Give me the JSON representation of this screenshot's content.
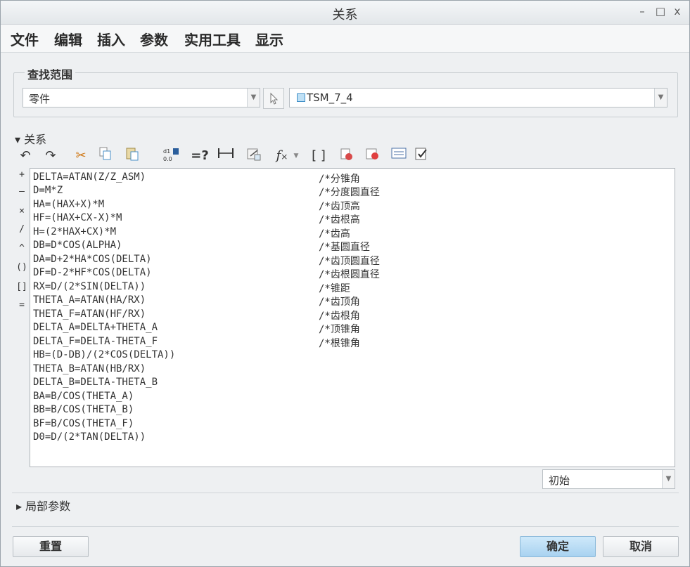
{
  "window": {
    "title": "关系",
    "min": "–",
    "max": "□",
    "close": "x"
  },
  "menu": [
    "文件",
    "编辑",
    "插入",
    "参数",
    "实用工具",
    "显示"
  ],
  "lookup": {
    "group_title": "查找范围",
    "scope_value": "零件",
    "model_value": "TSM_7_4"
  },
  "relations": {
    "section_label": "关系",
    "side_ops": [
      "+",
      "–",
      "×",
      "/",
      "^",
      "()",
      "[]",
      "="
    ],
    "lines": [
      "DELTA=ATAN(Z/Z_ASM)",
      "D=M*Z",
      "HA=(HAX+X)*M",
      "HF=(HAX+CX-X)*M",
      "H=(2*HAX+CX)*M",
      "DB=D*COS(ALPHA)",
      "DA=D+2*HA*COS(DELTA)",
      "DF=D-2*HF*COS(DELTA)",
      "RX=D/(2*SIN(DELTA))",
      "THETA_A=ATAN(HA/RX)",
      "THETA_F=ATAN(HF/RX)",
      "DELTA_A=DELTA+THETA_A",
      "DELTA_F=DELTA-THETA_F",
      "HB=(D-DB)/(2*COS(DELTA))",
      "THETA_B=ATAN(HB/RX)",
      "DELTA_B=DELTA-THETA_B",
      "BA=B/COS(THETA_A)",
      "BB=B/COS(THETA_B)",
      "BF=B/COS(THETA_F)",
      "D0=D/(2*TAN(DELTA))"
    ],
    "comments": [
      "/*分锥角",
      "/*分度圆直径",
      "/*齿顶高",
      "/*齿根高",
      "/*齿高",
      "/*基圆直径",
      "/*齿顶圆直径",
      "/*齿根圆直径",
      "/*锥距",
      "/*齿顶角",
      "/*齿根角",
      "/*顶锥角",
      "/*根锥角"
    ],
    "units_value": "初始"
  },
  "local_params": {
    "label": "局部参数"
  },
  "buttons": {
    "reset": "重置",
    "ok": "确定",
    "cancel": "取消"
  }
}
